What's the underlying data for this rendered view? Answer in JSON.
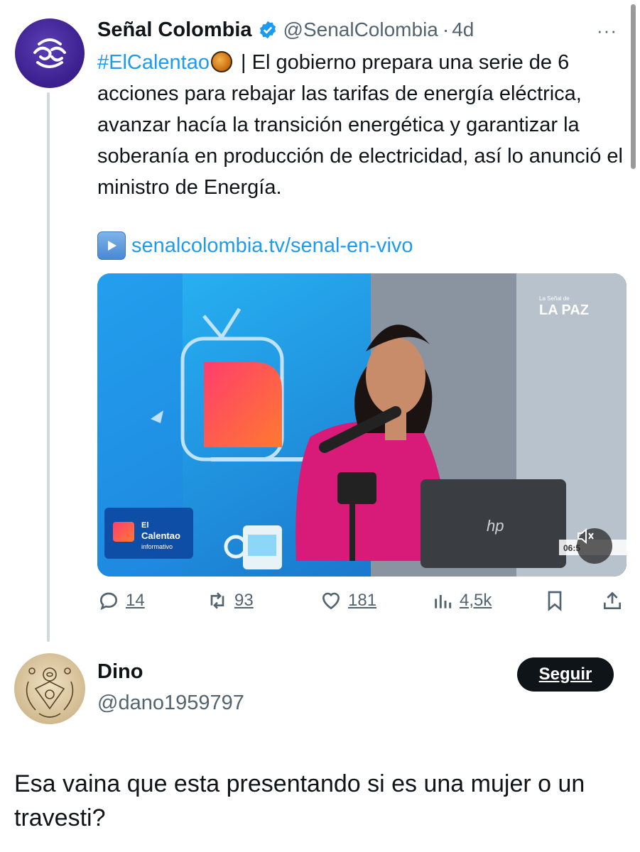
{
  "tweet": {
    "author_name": "Señal Colombia",
    "author_handle": "@SenalColombia",
    "separator": "·",
    "time": "4d",
    "more_label": "···",
    "hashtag": "#ElCalentao",
    "text_after_hashtag": " | El gobierno prepara una serie de 6 acciones para rebajar las tarifas de energía eléctrica, avanzar hacía la transición energética y garantizar la soberanía en producción de electricidad, así lo anunció el ministro de Energía.",
    "link_text": "senalcolombia.tv/senal-en-vivo",
    "media": {
      "overlay_logo_line1": "El",
      "overlay_logo_line2": "Calentao",
      "overlay_logo_line3": "informativo",
      "channel_bug_small": "La Señal de",
      "channel_bug": "LA PAZ",
      "clock": "06:5",
      "laptop_brand": "hp"
    },
    "actions": {
      "replies": "14",
      "retweets": "93",
      "likes": "181",
      "views": "4,5k"
    },
    "colors": {
      "accent": "#1d9bf0",
      "text": "#0f1419",
      "muted": "#536471"
    }
  },
  "reply": {
    "author_name": "Dino",
    "author_handle": "@dano1959797",
    "follow_label": "Seguir",
    "text": "Esa vaina que esta presentando si es una mujer o un travesti?"
  }
}
